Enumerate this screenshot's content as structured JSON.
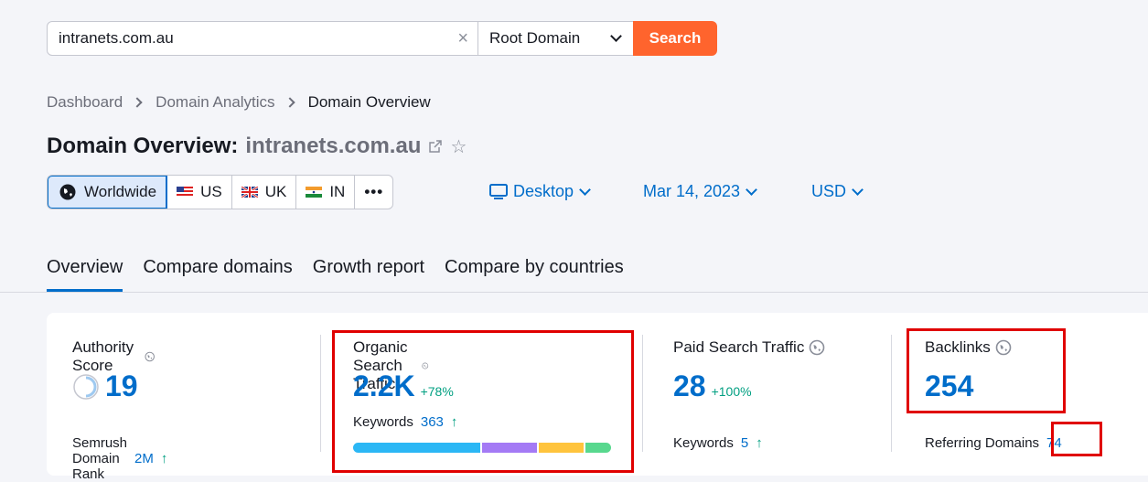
{
  "search": {
    "value": "intranets.com.au",
    "scope": "Root Domain",
    "button": "Search"
  },
  "breadcrumb": [
    "Dashboard",
    "Domain Analytics",
    "Domain Overview"
  ],
  "title": {
    "prefix": "Domain Overview:",
    "domain": "intranets.com.au"
  },
  "regions": [
    {
      "label": "Worldwide",
      "active": true
    },
    {
      "label": "US"
    },
    {
      "label": "UK"
    },
    {
      "label": "IN"
    },
    {
      "label": "•••"
    }
  ],
  "filters": {
    "device": "Desktop",
    "date": "Mar 14, 2023",
    "currency": "USD"
  },
  "tabs": [
    "Overview",
    "Compare domains",
    "Growth report",
    "Compare by countries"
  ],
  "metrics": {
    "authority": {
      "label": "Authority Score",
      "value": "19",
      "sub_label": "Semrush Domain Rank",
      "sub_value": "2M",
      "sub_arrow": "↑"
    },
    "organic": {
      "label": "Organic Search Traffic",
      "value": "2.2K",
      "delta": "+78%",
      "sub_label": "Keywords",
      "sub_value": "363",
      "sub_arrow": "↑"
    },
    "paid": {
      "label": "Paid Search Traffic",
      "value": "28",
      "delta": "+100%",
      "sub_label": "Keywords",
      "sub_value": "5",
      "sub_arrow": "↑"
    },
    "backlinks": {
      "label": "Backlinks",
      "value": "254",
      "sub_label": "Referring Domains",
      "sub_value": "74"
    }
  },
  "keyword_distribution": [
    {
      "color": "#2bb7f5",
      "share": 0.505
    },
    {
      "color": "#a47af5",
      "share": 0.215
    },
    {
      "color": "#ffc43d",
      "share": 0.18
    },
    {
      "color": "#58d88e",
      "share": 0.1
    }
  ],
  "colors": {
    "accent": "#006dca",
    "brand_orange": "#ff642d",
    "positive": "#009f81",
    "highlight_box": "#e00000"
  }
}
